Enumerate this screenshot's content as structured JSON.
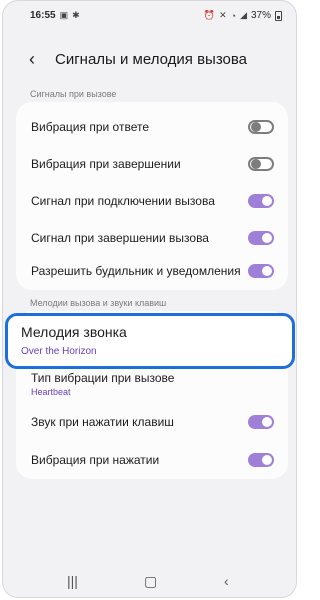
{
  "status_bar": {
    "time": "16:55",
    "battery_text": "37%",
    "icons": [
      "gallery-icon",
      "settings-icon",
      "alarm-icon",
      "mute-icon",
      "wifi-icon",
      "lte-signal-icon",
      "signal-icon",
      "battery-icon"
    ]
  },
  "header": {
    "back_icon": "chevron-left-icon",
    "title": "Сигналы и мелодия вызова"
  },
  "section1": {
    "label": "Сигналы при вызове",
    "items": [
      {
        "label": "Вибрация при ответе",
        "toggle": "off"
      },
      {
        "label": "Вибрация при завершении",
        "toggle": "off"
      },
      {
        "label": "Сигнал при подключении вызова",
        "toggle": "on"
      },
      {
        "label": "Сигнал при завершении вызова",
        "toggle": "on"
      },
      {
        "label": "Разрешить будильник и уведомления",
        "toggle": "on"
      }
    ]
  },
  "section2": {
    "label": "Мелодии вызова и звуки клавиш",
    "ringtone": {
      "label": "Мелодия звонка",
      "value": "Over the Horizon"
    },
    "vibration_type": {
      "label": "Тип вибрации при вызове",
      "value": "Heartbeat"
    },
    "items": [
      {
        "label": "Звук при нажатии клавиш",
        "toggle": "on"
      },
      {
        "label": "Вибрация при нажатии",
        "toggle": "on"
      }
    ]
  },
  "colors": {
    "accent": "#9f80d9",
    "highlight_border": "#1f6fdb",
    "subtext": "#6b3fbf"
  },
  "navigation": {
    "recents_icon": "recents-icon",
    "home_icon": "home-icon",
    "back_icon": "back-icon"
  }
}
